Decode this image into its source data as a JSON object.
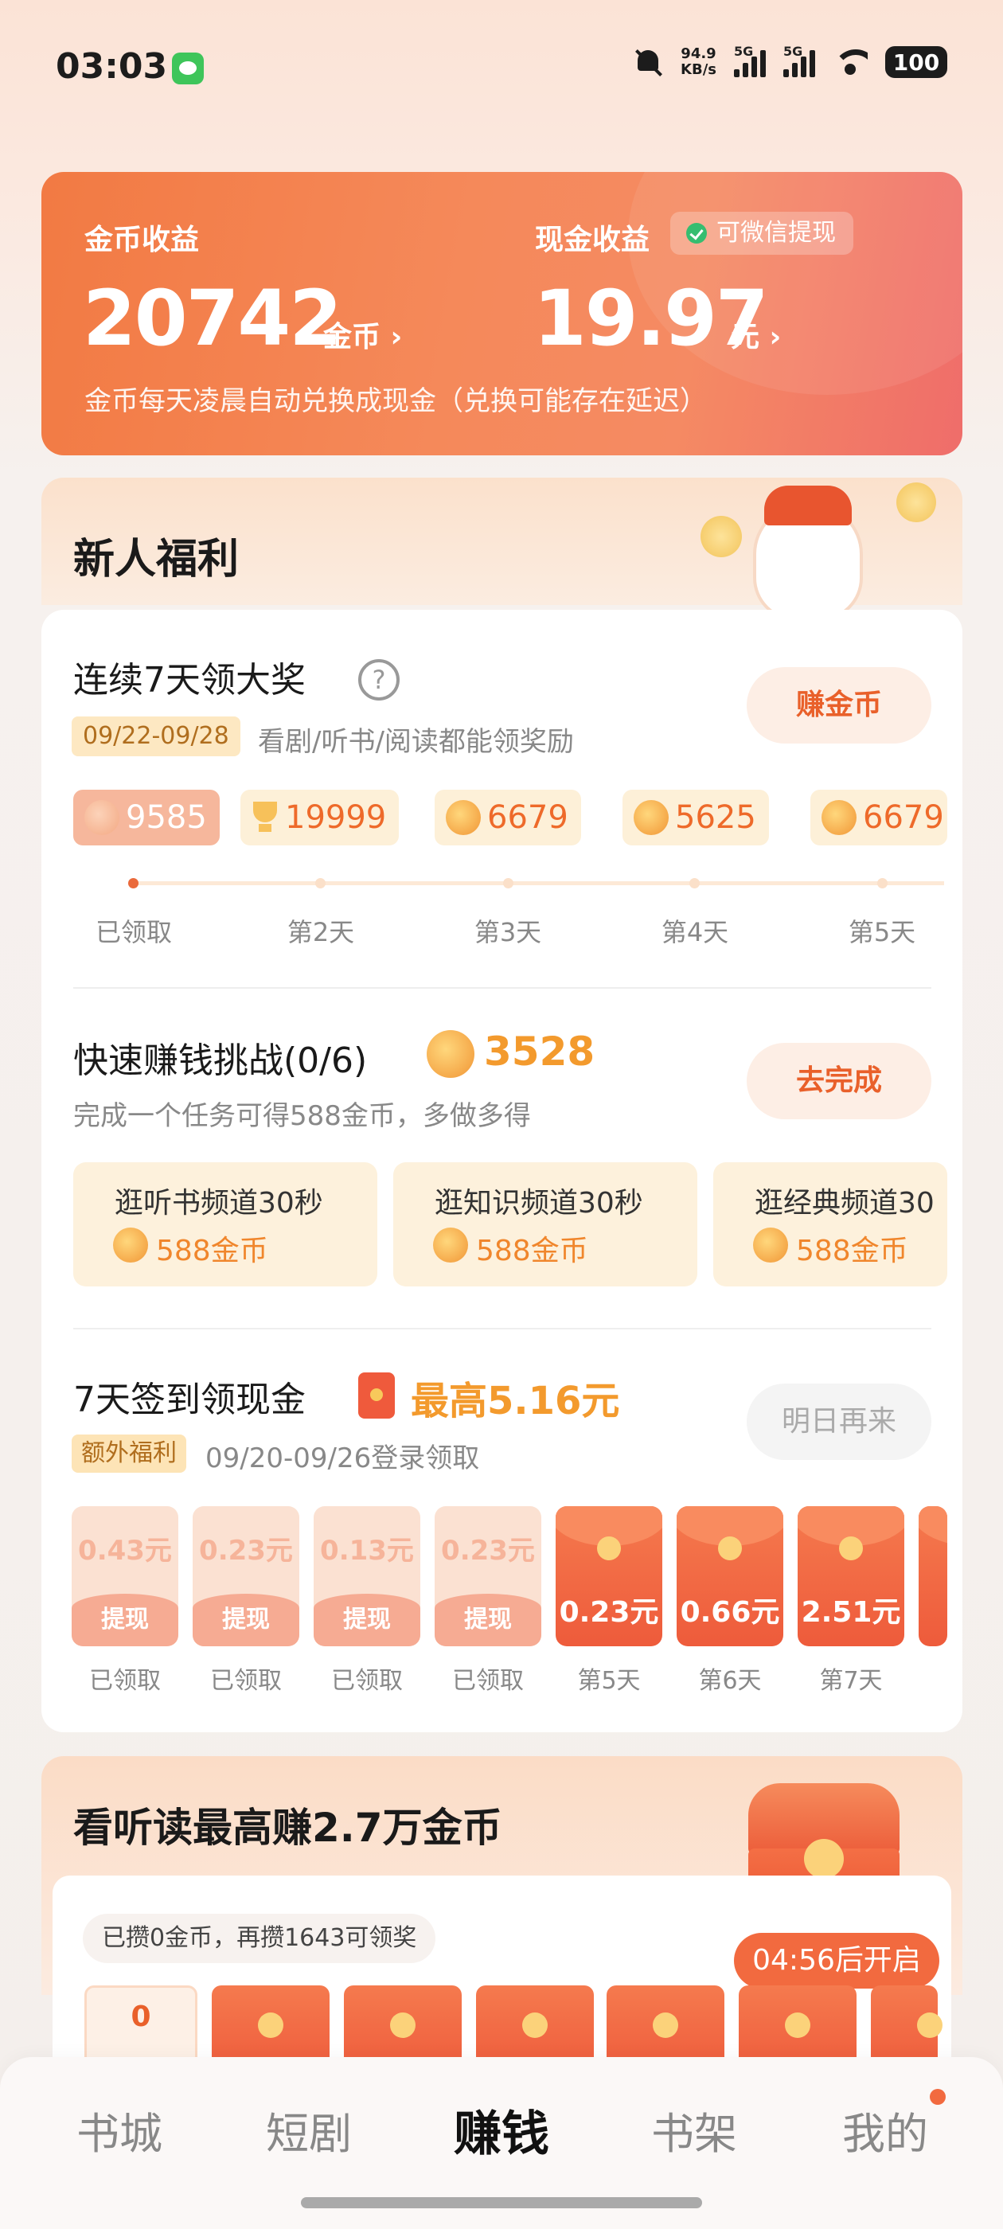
{
  "status_bar": {
    "time": "03:03",
    "net_speed_value": "94.9",
    "net_speed_unit": "KB/s",
    "signal1": "5G",
    "signal2": "5G",
    "battery": "100"
  },
  "earnings": {
    "coin_label": "金币收益",
    "coin_value": "20742",
    "coin_unit": "金币 ›",
    "cash_label": "现金收益",
    "wechat_badge": "可微信提现",
    "cash_value": "19.97",
    "cash_unit": "元 ›",
    "note": "金币每天凌晨自动兑换成现金（兑换可能存在延迟）"
  },
  "welfare": {
    "title": "新人福利"
  },
  "streak": {
    "title": "连续7天领大奖",
    "help": "?",
    "date_range": "09/22-09/28",
    "desc": "看剧/听书/阅读都能领奖励",
    "button": "赚金币",
    "rewards": [
      "9585",
      "19999",
      "6679",
      "5625",
      "6679"
    ],
    "days": [
      "已领取",
      "第2天",
      "第3天",
      "第4天",
      "第5天"
    ]
  },
  "quick": {
    "title": "快速赚钱挑战(0/6)",
    "coins": "3528",
    "desc": "完成一个任务可得588金币，多做多得",
    "button": "去完成",
    "tasks": [
      {
        "name": "逛听书频道30秒",
        "reward": "588金币"
      },
      {
        "name": "逛知识频道30秒",
        "reward": "588金币"
      },
      {
        "name": "逛经典频道30",
        "reward": "588金币"
      }
    ]
  },
  "signin": {
    "title": "7天签到领现金",
    "max": "最高5.16元",
    "tag": "额外福利",
    "desc": "09/20-09/26登录领取",
    "button": "明日再来",
    "claimed": [
      {
        "amount": "0.43元",
        "action": "提现",
        "label": "已领取"
      },
      {
        "amount": "0.23元",
        "action": "提现",
        "label": "已领取"
      },
      {
        "amount": "0.13元",
        "action": "提现",
        "label": "已领取"
      },
      {
        "amount": "0.23元",
        "action": "提现",
        "label": "已领取"
      }
    ],
    "pending": [
      {
        "amount": "0.23元",
        "label": "第5天"
      },
      {
        "amount": "0.66元",
        "label": "第6天"
      },
      {
        "amount": "2.51元",
        "label": "第7天"
      }
    ]
  },
  "reading": {
    "title": "看听读最高赚2.7万金币",
    "saved": "已攒0金币，再攒1643可领奖",
    "countdown": "04:56后开启",
    "first_value": "0"
  },
  "tabs": [
    "书城",
    "短剧",
    "赚钱",
    "书架",
    "我的"
  ],
  "colors": {
    "accent": "#f27a43",
    "coin": "#f39a2d"
  }
}
